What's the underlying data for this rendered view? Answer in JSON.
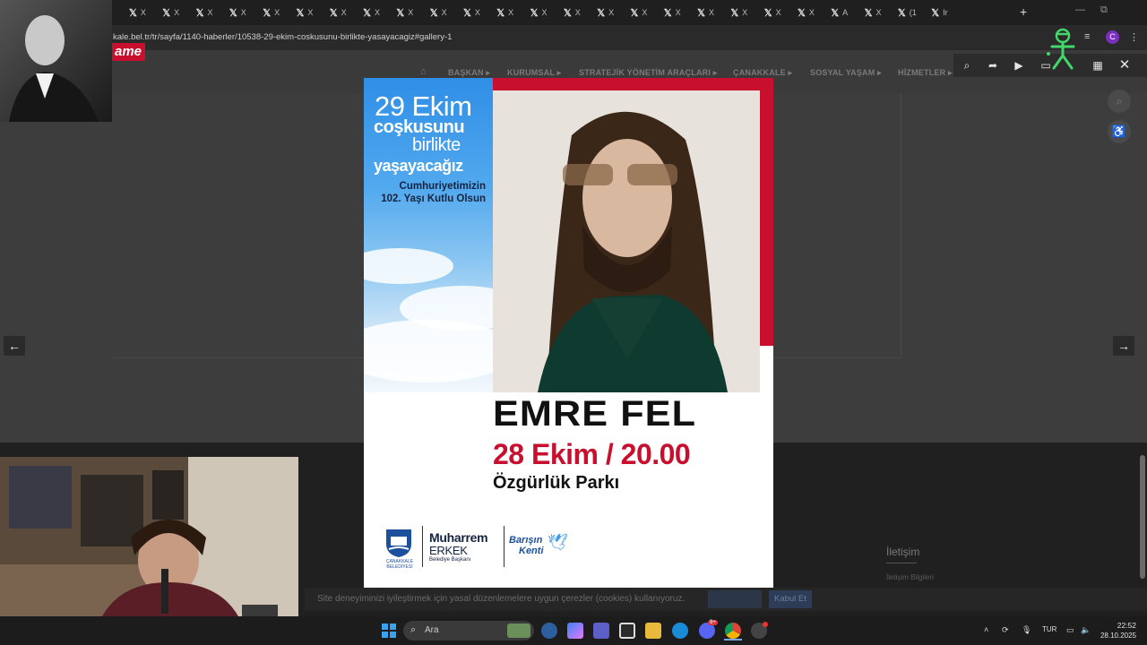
{
  "browser": {
    "tabs": [
      "X",
      "X",
      "X",
      "X",
      "X",
      "X",
      "X",
      "X",
      "X",
      "X",
      "X",
      "X",
      "X",
      "X",
      "X",
      "X",
      "X",
      "X",
      "X",
      "X",
      "X",
      "A",
      "X",
      "(1",
      "Ir"
    ],
    "url": "kale.bel.tr/tr/sayfa/1140-haberler/10538-29-ekim-coskusunu-birlikte-yasayacagiz#gallery-1",
    "avatar_letter": "C"
  },
  "site": {
    "logo_text": "ame",
    "nav": [
      "BAŞKAN",
      "KURUMSAL",
      "STRATEJİK YÖNETİM ARAÇLARI",
      "ÇANAKKALE",
      "SOSYAL YAŞAM",
      "HİZMETLER"
    ],
    "footer_heading": "İletişim",
    "footer_link": "İletişim Bilgileri"
  },
  "poster": {
    "headline_1": "29 Ekim",
    "headline_2": "coşkusunu",
    "headline_3": "birlikte",
    "headline_4": "yaşayacağız",
    "subline_1": "Cumhuriyetimizin",
    "subline_2": "102. Yaşı Kutlu Olsun",
    "artist": "EMRE FEL",
    "date_time": "28 Ekim / 20.00",
    "venue": "Özgürlük Parkı",
    "logo_city_1": "ÇANAKKALE",
    "logo_city_2": "BELEDİYESİ",
    "mayor_first": "Muharrem",
    "mayor_last": "ERKEK",
    "mayor_title": "Belediye Başkanı",
    "slogan_1": "Barışın",
    "slogan_2": "Kenti",
    "colors": {
      "red": "#c8102e",
      "navy": "#14233f",
      "sky": "#3d9be9"
    }
  },
  "cookie": {
    "text": "Site deneyiminizi iyileştirmek için yasal düzenlemelere uygun çerezler (cookies) kullanıyoruz.",
    "accept": "Kabul Et"
  },
  "taskbar": {
    "search_placeholder": "Ara",
    "discord_badge": "9+",
    "lang": "TUR",
    "time": "22:52",
    "date": "28.10.2025"
  }
}
